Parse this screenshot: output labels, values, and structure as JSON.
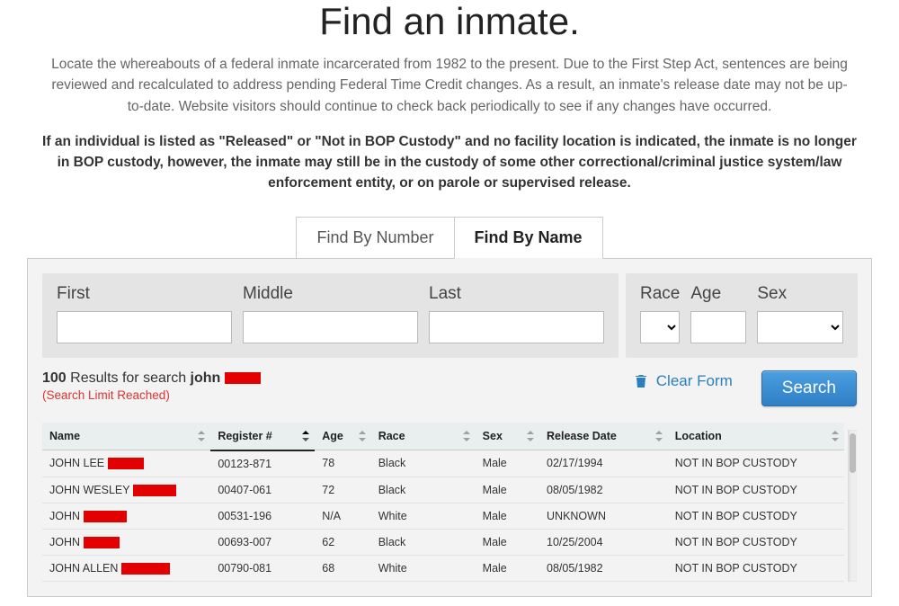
{
  "header": {
    "title": "Find an inmate.",
    "intro": "Locate the whereabouts of a federal inmate incarcerated from 1982 to the present. Due to the First Step Act, sentences are being reviewed and recalculated to address pending Federal Time Credit changes. As a result, an inmate's release date may not be up-to-date. Website visitors should continue to check back periodically to see if any changes have occurred.",
    "notice": "If an individual is listed as \"Released\" or \"Not in BOP Custody\" and no facility location is indicated, the inmate is no longer in BOP custody, however, the inmate may still be in the custody of some other correctional/criminal justice system/law enforcement entity, or on parole or supervised release."
  },
  "tabs": {
    "by_number": "Find By Number",
    "by_name": "Find By Name",
    "active": "by_name"
  },
  "filters": {
    "first_label": "First",
    "middle_label": "Middle",
    "last_label": "Last",
    "race_label": "Race",
    "age_label": "Age",
    "sex_label": "Sex",
    "first_value": "",
    "middle_value": "",
    "last_value": "",
    "race_value": "",
    "age_value": "",
    "sex_value": ""
  },
  "actions": {
    "clear": "Clear Form",
    "search": "Search"
  },
  "results_summary": {
    "count": "100",
    "results_for": "Results for search",
    "term_first": "john",
    "limit": "(Search Limit Reached)"
  },
  "columns": {
    "name": "Name",
    "register": "Register #",
    "age": "Age",
    "race": "Race",
    "sex": "Sex",
    "release": "Release Date",
    "location": "Location"
  },
  "rows": [
    {
      "name_prefix": "JOHN LEE",
      "register": "00123-871",
      "age": "78",
      "race": "Black",
      "sex": "Male",
      "release": "02/17/1994",
      "location": "NOT IN BOP CUSTODY"
    },
    {
      "name_prefix": "JOHN WESLEY",
      "register": "00407-061",
      "age": "72",
      "race": "Black",
      "sex": "Male",
      "release": "08/05/1982",
      "location": "NOT IN BOP CUSTODY"
    },
    {
      "name_prefix": "JOHN",
      "register": "00531-196",
      "age": "N/A",
      "race": "White",
      "sex": "Male",
      "release": "UNKNOWN",
      "location": "NOT IN BOP CUSTODY"
    },
    {
      "name_prefix": "JOHN",
      "register": "00693-007",
      "age": "62",
      "race": "Black",
      "sex": "Male",
      "release": "10/25/2004",
      "location": "NOT IN BOP CUSTODY"
    },
    {
      "name_prefix": "JOHN ALLEN",
      "register": "00790-081",
      "age": "68",
      "race": "White",
      "sex": "Male",
      "release": "08/05/1982",
      "location": "NOT IN BOP CUSTODY"
    }
  ],
  "redaction_widths": {
    "term": 40,
    "row": [
      40,
      48,
      48,
      40,
      54
    ]
  }
}
